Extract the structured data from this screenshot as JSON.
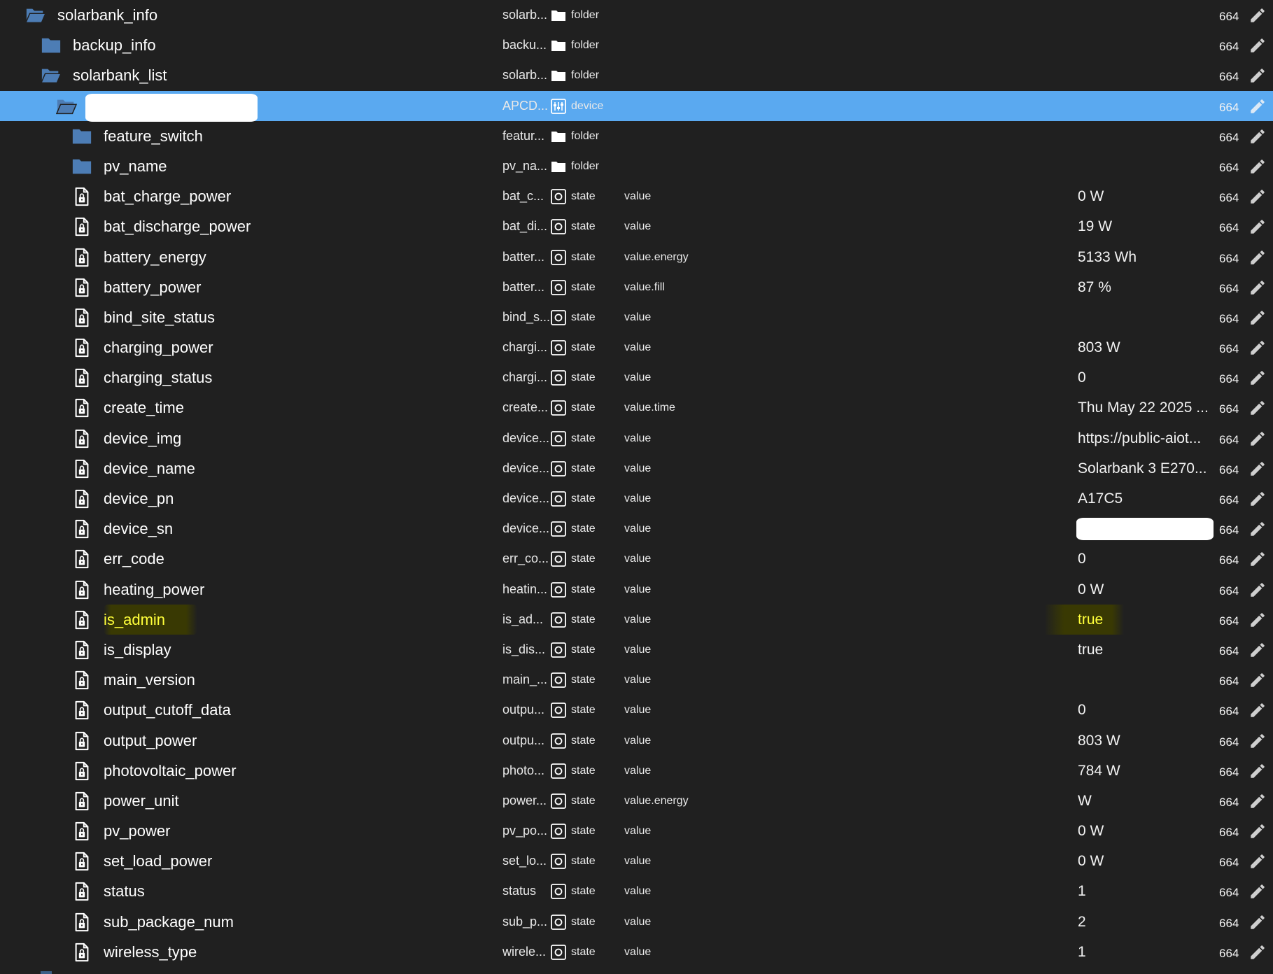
{
  "colors": {
    "background": "#202020",
    "selection": "#5aa9f0",
    "folder_icon": "#4d7db5",
    "text": "#ffffff",
    "highlight_text": "#ffff3a"
  },
  "rows": [
    {
      "name": "solarbank_info",
      "col": "solarb...",
      "type": "folder",
      "type_icon": "folder-icon",
      "role": "",
      "value": "",
      "acl": "664",
      "indent": 0,
      "icon": "folder-open-icon"
    },
    {
      "name": "backup_info",
      "col": "backu...",
      "type": "folder",
      "type_icon": "folder-icon",
      "role": "",
      "value": "",
      "acl": "664",
      "indent": 1,
      "icon": "folder-closed-icon"
    },
    {
      "name": "solarbank_list",
      "col": "solarb...",
      "type": "folder",
      "type_icon": "folder-icon",
      "role": "",
      "value": "",
      "acl": "664",
      "indent": 1,
      "icon": "folder-open-icon"
    },
    {
      "name": "",
      "col": "APCD...",
      "type": "device",
      "type_icon": "device-icon",
      "role": "",
      "value": "",
      "acl": "664",
      "indent": 2,
      "icon": "folder-open-icon",
      "selected": true,
      "redacted_name": true
    },
    {
      "name": "feature_switch",
      "col": "featur...",
      "type": "folder",
      "type_icon": "folder-icon",
      "role": "",
      "value": "",
      "acl": "664",
      "indent": 3,
      "icon": "folder-closed-icon"
    },
    {
      "name": "pv_name",
      "col": "pv_na...",
      "type": "folder",
      "type_icon": "folder-icon",
      "role": "",
      "value": "",
      "acl": "664",
      "indent": 3,
      "icon": "folder-closed-icon"
    },
    {
      "name": "bat_charge_power",
      "col": "bat_c...",
      "type": "state",
      "type_icon": "state-icon",
      "role": "value",
      "value": "0 W",
      "acl": "664",
      "indent": 3,
      "icon": "file-lock-icon"
    },
    {
      "name": "bat_discharge_power",
      "col": "bat_di...",
      "type": "state",
      "type_icon": "state-icon",
      "role": "value",
      "value": "19 W",
      "acl": "664",
      "indent": 3,
      "icon": "file-lock-icon"
    },
    {
      "name": "battery_energy",
      "col": "batter...",
      "type": "state",
      "type_icon": "state-icon",
      "role": "value.energy",
      "value": "5133 Wh",
      "acl": "664",
      "indent": 3,
      "icon": "file-lock-icon"
    },
    {
      "name": "battery_power",
      "col": "batter...",
      "type": "state",
      "type_icon": "state-icon",
      "role": "value.fill",
      "value": "87 %",
      "acl": "664",
      "indent": 3,
      "icon": "file-lock-icon"
    },
    {
      "name": "bind_site_status",
      "col": "bind_s...",
      "type": "state",
      "type_icon": "state-icon",
      "role": "value",
      "value": "",
      "acl": "664",
      "indent": 3,
      "icon": "file-lock-icon"
    },
    {
      "name": "charging_power",
      "col": "chargi...",
      "type": "state",
      "type_icon": "state-icon",
      "role": "value",
      "value": "803 W",
      "acl": "664",
      "indent": 3,
      "icon": "file-lock-icon"
    },
    {
      "name": "charging_status",
      "col": "chargi...",
      "type": "state",
      "type_icon": "state-icon",
      "role": "value",
      "value": "0",
      "acl": "664",
      "indent": 3,
      "icon": "file-lock-icon"
    },
    {
      "name": "create_time",
      "col": "create...",
      "type": "state",
      "type_icon": "state-icon",
      "role": "value.time",
      "value": "Thu May 22 2025 ...",
      "acl": "664",
      "indent": 3,
      "icon": "file-lock-icon"
    },
    {
      "name": "device_img",
      "col": "device...",
      "type": "state",
      "type_icon": "state-icon",
      "role": "value",
      "value": "https://public-aiot...",
      "acl": "664",
      "indent": 3,
      "icon": "file-lock-icon"
    },
    {
      "name": "device_name",
      "col": "device...",
      "type": "state",
      "type_icon": "state-icon",
      "role": "value",
      "value": "Solarbank 3 E270...",
      "acl": "664",
      "indent": 3,
      "icon": "file-lock-icon"
    },
    {
      "name": "device_pn",
      "col": "device...",
      "type": "state",
      "type_icon": "state-icon",
      "role": "value",
      "value": "A17C5",
      "acl": "664",
      "indent": 3,
      "icon": "file-lock-icon"
    },
    {
      "name": "device_sn",
      "col": "device...",
      "type": "state",
      "type_icon": "state-icon",
      "role": "value",
      "value": "",
      "acl": "664",
      "indent": 3,
      "icon": "file-lock-icon",
      "redacted_value": true
    },
    {
      "name": "err_code",
      "col": "err_co...",
      "type": "state",
      "type_icon": "state-icon",
      "role": "value",
      "value": "0",
      "acl": "664",
      "indent": 3,
      "icon": "file-lock-icon"
    },
    {
      "name": "heating_power",
      "col": "heatin...",
      "type": "state",
      "type_icon": "state-icon",
      "role": "value",
      "value": "0 W",
      "acl": "664",
      "indent": 3,
      "icon": "file-lock-icon"
    },
    {
      "name": "is_admin",
      "col": "is_ad...",
      "type": "state",
      "type_icon": "state-icon",
      "role": "value",
      "value": "true",
      "acl": "664",
      "indent": 3,
      "icon": "file-lock-icon",
      "highlighted": true
    },
    {
      "name": "is_display",
      "col": "is_dis...",
      "type": "state",
      "type_icon": "state-icon",
      "role": "value",
      "value": "true",
      "acl": "664",
      "indent": 3,
      "icon": "file-lock-icon"
    },
    {
      "name": "main_version",
      "col": "main_...",
      "type": "state",
      "type_icon": "state-icon",
      "role": "value",
      "value": "",
      "acl": "664",
      "indent": 3,
      "icon": "file-lock-icon"
    },
    {
      "name": "output_cutoff_data",
      "col": "outpu...",
      "type": "state",
      "type_icon": "state-icon",
      "role": "value",
      "value": "0",
      "acl": "664",
      "indent": 3,
      "icon": "file-lock-icon"
    },
    {
      "name": "output_power",
      "col": "outpu...",
      "type": "state",
      "type_icon": "state-icon",
      "role": "value",
      "value": "803 W",
      "acl": "664",
      "indent": 3,
      "icon": "file-lock-icon"
    },
    {
      "name": "photovoltaic_power",
      "col": "photo...",
      "type": "state",
      "type_icon": "state-icon",
      "role": "value",
      "value": "784 W",
      "acl": "664",
      "indent": 3,
      "icon": "file-lock-icon"
    },
    {
      "name": "power_unit",
      "col": "power...",
      "type": "state",
      "type_icon": "state-icon",
      "role": "value.energy",
      "value": "W",
      "acl": "664",
      "indent": 3,
      "icon": "file-lock-icon"
    },
    {
      "name": "pv_power",
      "col": "pv_po...",
      "type": "state",
      "type_icon": "state-icon",
      "role": "value",
      "value": "0 W",
      "acl": "664",
      "indent": 3,
      "icon": "file-lock-icon"
    },
    {
      "name": "set_load_power",
      "col": "set_lo...",
      "type": "state",
      "type_icon": "state-icon",
      "role": "value",
      "value": "0 W",
      "acl": "664",
      "indent": 3,
      "icon": "file-lock-icon"
    },
    {
      "name": "status",
      "col": "status",
      "type": "state",
      "type_icon": "state-icon",
      "role": "value",
      "value": "1",
      "acl": "664",
      "indent": 3,
      "icon": "file-lock-icon"
    },
    {
      "name": "sub_package_num",
      "col": "sub_p...",
      "type": "state",
      "type_icon": "state-icon",
      "role": "value",
      "value": "2",
      "acl": "664",
      "indent": 3,
      "icon": "file-lock-icon"
    },
    {
      "name": "wireless_type",
      "col": "wirele...",
      "type": "state",
      "type_icon": "state-icon",
      "role": "value",
      "value": "1",
      "acl": "664",
      "indent": 3,
      "icon": "file-lock-icon"
    }
  ]
}
